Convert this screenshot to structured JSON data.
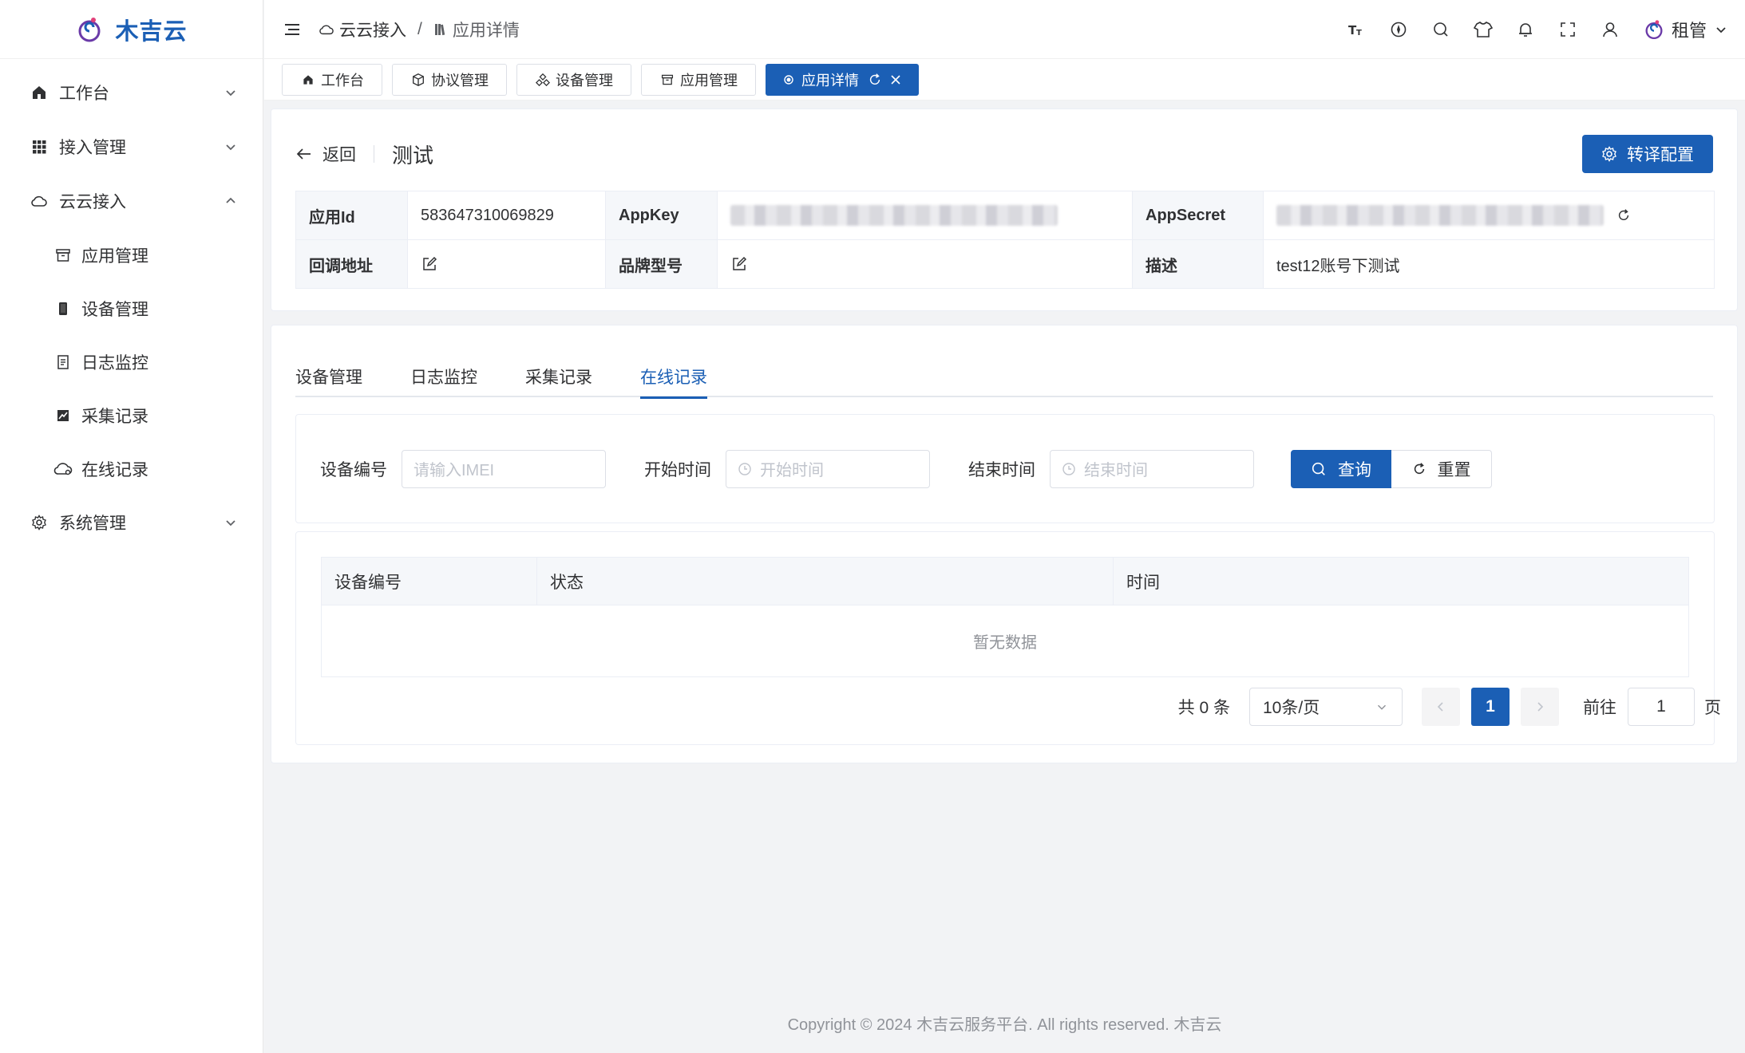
{
  "brand": {
    "name": "木吉云"
  },
  "sidebar": {
    "items": [
      {
        "label": "工作台",
        "icon": "home-icon",
        "expanded": false
      },
      {
        "label": "接入管理",
        "icon": "grid-icon",
        "expanded": false
      },
      {
        "label": "云云接入",
        "icon": "cloud-icon",
        "expanded": true,
        "children": [
          {
            "label": "应用管理",
            "icon": "archive-icon"
          },
          {
            "label": "设备管理",
            "icon": "phone-icon"
          },
          {
            "label": "日志监控",
            "icon": "document-icon"
          },
          {
            "label": "采集记录",
            "icon": "chart-icon"
          },
          {
            "label": "在线记录",
            "icon": "cloud-online-icon"
          }
        ]
      },
      {
        "label": "系统管理",
        "icon": "gear-icon",
        "expanded": false
      }
    ]
  },
  "header": {
    "breadcrumb": [
      "云云接入",
      "应用详情"
    ],
    "separator": "/",
    "user": "租管"
  },
  "tags": [
    {
      "label": "工作台",
      "icon": "home-icon",
      "active": false
    },
    {
      "label": "协议管理",
      "icon": "box-icon",
      "active": false
    },
    {
      "label": "设备管理",
      "icon": "devices-icon",
      "active": false
    },
    {
      "label": "应用管理",
      "icon": "archive-icon",
      "active": false
    },
    {
      "label": "应用详情",
      "icon": "dot-icon",
      "active": true
    }
  ],
  "detail": {
    "back_label": "返回",
    "title": "测试",
    "config_button": "转译配置",
    "fields": {
      "app_id_label": "应用Id",
      "app_id_value": "583647310069829",
      "app_key_label": "AppKey",
      "app_secret_label": "AppSecret",
      "callback_label": "回调地址",
      "brand_model_label": "品牌型号",
      "desc_label": "描述",
      "desc_value": "test12账号下测试"
    }
  },
  "tabs": [
    "设备管理",
    "日志监控",
    "采集记录",
    "在线记录"
  ],
  "active_tab": "在线记录",
  "filters": {
    "device_label": "设备编号",
    "device_placeholder": "请输入IMEI",
    "start_label": "开始时间",
    "start_placeholder": "开始时间",
    "end_label": "结束时间",
    "end_placeholder": "结束时间",
    "query_button": "查询",
    "reset_button": "重置"
  },
  "table": {
    "columns": [
      "设备编号",
      "状态",
      "时间"
    ],
    "empty_text": "暂无数据"
  },
  "pagination": {
    "total": "共 0 条",
    "page_size": "10条/页",
    "current_page": "1",
    "goto_label": "前往",
    "goto_value": "1",
    "page_suffix": "页"
  },
  "footer": "Copyright © 2024 木吉云服务平台. All rights reserved. 木吉云",
  "colors": {
    "primary": "#1b5fb5",
    "logo_purple": "#6a3aa8"
  }
}
